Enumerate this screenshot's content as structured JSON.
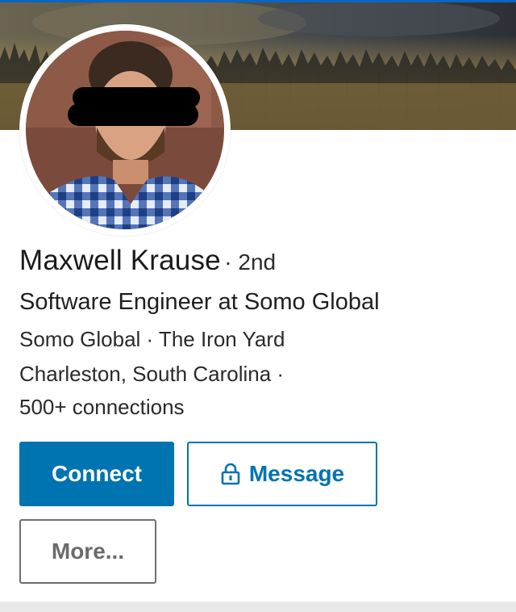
{
  "profile": {
    "name": "Maxwell Krause",
    "degree": "· 2nd",
    "headline": "Software Engineer at Somo Global",
    "companies": "Somo Global · The Iron Yard",
    "location": "Charleston, South Carolina ·",
    "connections": "500+ connections"
  },
  "actions": {
    "connect_label": "Connect",
    "message_label": "Message",
    "more_label": "More..."
  },
  "icons": {
    "message": "lock-icon"
  },
  "colors": {
    "accent": "#0073b1",
    "more_border": "#6e6e6e",
    "bottom_strip": "#e9e9e9"
  }
}
